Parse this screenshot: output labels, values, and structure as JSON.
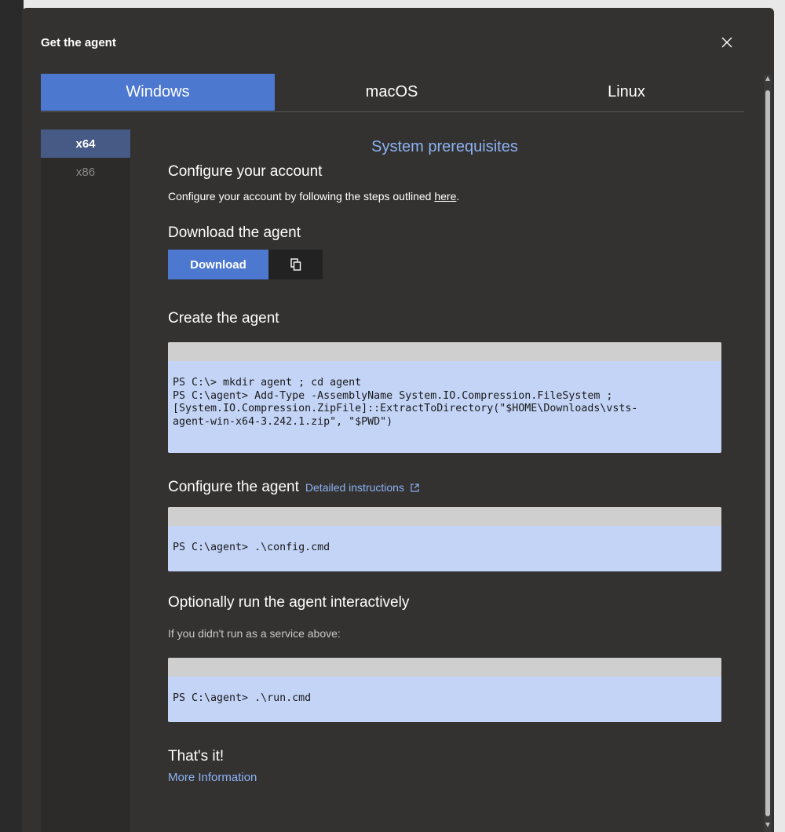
{
  "dialog": {
    "title": "Get the agent",
    "close_icon": "close-icon"
  },
  "tabs": [
    {
      "label": "Windows",
      "selected": true
    },
    {
      "label": "macOS",
      "selected": false
    },
    {
      "label": "Linux",
      "selected": false
    }
  ],
  "architectures": [
    {
      "label": "x64",
      "selected": true
    },
    {
      "label": "x86",
      "selected": false
    }
  ],
  "content": {
    "prereq_link": "System prerequisites",
    "configure_account": {
      "heading": "Configure your account",
      "text": "Configure your account by following the steps outlined ",
      "link": "here",
      "suffix": "."
    },
    "download": {
      "heading": "Download the agent",
      "button_label": "Download",
      "copy_icon": "copy-icon"
    },
    "create": {
      "heading": "Create the agent",
      "code": "PS C:\\> mkdir agent ; cd agent\nPS C:\\agent> Add-Type -AssemblyName System.IO.Compression.FileSystem ;\n[System.IO.Compression.ZipFile]::ExtractToDirectory(\"$HOME\\Downloads\\vsts-\nagent-win-x64-3.242.1.zip\", \"$PWD\")"
    },
    "configure": {
      "heading": "Configure the agent",
      "link": "Detailed instructions",
      "link_icon": "external-link-icon",
      "code": "PS C:\\agent> .\\config.cmd"
    },
    "run": {
      "heading": "Optionally run the agent interactively",
      "text": "If you didn't run as a service above:",
      "code": "PS C:\\agent> .\\run.cmd"
    },
    "done": {
      "heading": "That's it!",
      "link": "More Information"
    }
  },
  "colors": {
    "dialog_bg": "#333231",
    "accent": "#4d78d0",
    "link": "#8cb2f2",
    "code_bg": "#c3d4f7"
  }
}
